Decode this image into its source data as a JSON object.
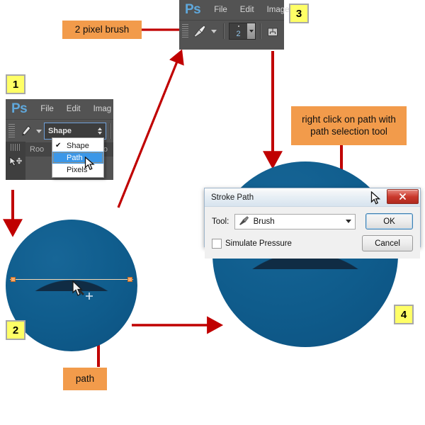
{
  "meta": {
    "accent_red": "#c00000",
    "callout_orange": "#f29b4b",
    "badge_yellow": "#ffff66",
    "circle_blue": "#0f5c8c",
    "path_dark": "#0c2a42",
    "ps_chrome": "#535353"
  },
  "brush_toolbar": {
    "logo": "Ps",
    "menu": [
      "File",
      "Edit",
      "Image"
    ],
    "brush_icon": "brush-icon",
    "preset_caret": "chevron-down-icon",
    "size_value": "2",
    "size_spinner": "chevron-down-icon",
    "tablet_icon": "tablet-pressure-icon"
  },
  "shape_toolbar": {
    "logo": "Ps",
    "menu": [
      "File",
      "Edit",
      "Imag"
    ],
    "pen_icon": "pen-tool-icon",
    "pen_caret": "chevron-down-icon",
    "mode_select": {
      "value": "Shape",
      "options": [
        "Shape",
        "Path",
        "Pixels"
      ],
      "checked": "Shape",
      "highlighted": "Path"
    },
    "tab_title_left": "Roo",
    "tab_title_right": "so",
    "tab_arrows": "»",
    "move_tool_icon": "move-tool-icon"
  },
  "callouts": {
    "brush": "2 pixel brush",
    "right_click": "right click on path with\npath selection tool",
    "right_click_line1": "right click on path with",
    "right_click_line2": "path selection tool",
    "path": "path"
  },
  "badges": [
    {
      "label": "1"
    },
    {
      "label": "2"
    },
    {
      "label": "3"
    },
    {
      "label": "4"
    }
  ],
  "dialog": {
    "title": "Stroke Path",
    "close_label": "✕",
    "tool_label": "Tool:",
    "tool_value": "Brush",
    "tool_icon": "brush-icon",
    "dropdown_caret": "chevron-down-icon",
    "checkbox_label": "Simulate Pressure",
    "checkbox_checked": false,
    "ok_label": "OK",
    "cancel_label": "Cancel"
  },
  "canvas": {
    "circle_before_name": "circle-with-path",
    "circle_after_name": "circle-with-stroked-path"
  }
}
